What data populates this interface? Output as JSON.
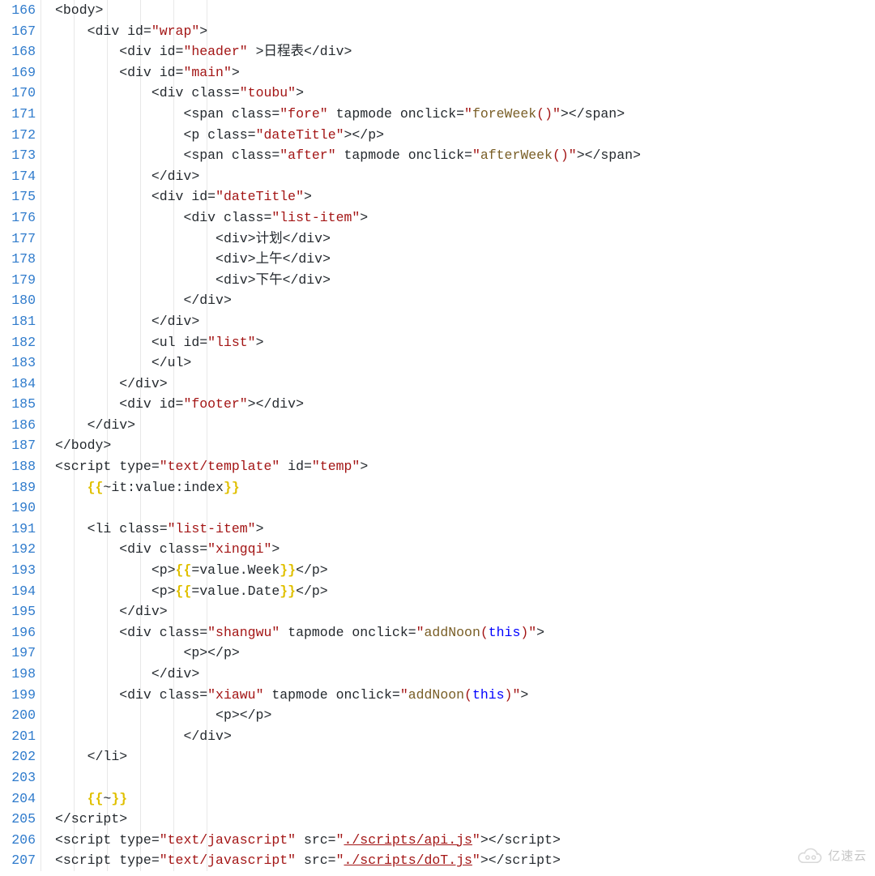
{
  "startLine": 166,
  "lines": [
    {
      "i": 0,
      "html": "<span class='tag'>&lt;body&gt;</span>"
    },
    {
      "i": 1,
      "html": "<span class='tag'>&lt;div</span> <span class='attr'>id=</span><span class='str'>\"wrap\"</span><span class='tag'>&gt;</span>"
    },
    {
      "i": 2,
      "html": "<span class='tag'>&lt;div</span> <span class='attr'>id=</span><span class='str'>\"header\"</span> <span class='tag'>&gt;</span><span class='txt'>日程表</span><span class='tag'>&lt;/div&gt;</span>"
    },
    {
      "i": 2,
      "html": "<span class='tag'>&lt;div</span> <span class='attr'>id=</span><span class='str'>\"main\"</span><span class='tag'>&gt;</span>"
    },
    {
      "i": 3,
      "html": "<span class='tag'>&lt;div</span> <span class='attr'>class=</span><span class='str'>\"toubu\"</span><span class='tag'>&gt;</span>"
    },
    {
      "i": 4,
      "html": "<span class='tag'>&lt;span</span> <span class='attr'>class=</span><span class='str'>\"fore\"</span> <span class='attr'>tapmode</span> <span class='attr'>onclick=</span><span class='str'>\"</span><span class='fn'>foreWeek</span><span class='paren'>()</span><span class='str'>\"</span><span class='tag'>&gt;&lt;/span&gt;</span>"
    },
    {
      "i": 4,
      "html": "<span class='tag'>&lt;p</span> <span class='attr'>class=</span><span class='str'>\"dateTitle\"</span><span class='tag'>&gt;&lt;/p&gt;</span>"
    },
    {
      "i": 4,
      "html": "<span class='tag'>&lt;span</span> <span class='attr'>class=</span><span class='str'>\"after\"</span> <span class='attr'>tapmode</span> <span class='attr'>onclick=</span><span class='str'>\"</span><span class='fn'>afterWeek</span><span class='paren'>()</span><span class='str'>\"</span><span class='tag'>&gt;&lt;/span&gt;</span>"
    },
    {
      "i": 3,
      "html": "<span class='tag'>&lt;/div&gt;</span>"
    },
    {
      "i": 3,
      "html": "<span class='tag'>&lt;div</span> <span class='attr'>id=</span><span class='str'>\"dateTitle\"</span><span class='tag'>&gt;</span>"
    },
    {
      "i": 4,
      "html": "<span class='tag'>&lt;div</span> <span class='attr'>class=</span><span class='str'>\"list-item\"</span><span class='tag'>&gt;</span>"
    },
    {
      "i": 5,
      "html": "<span class='tag'>&lt;div&gt;</span><span class='txt'>计划</span><span class='tag'>&lt;/div&gt;</span>"
    },
    {
      "i": 5,
      "html": "<span class='tag'>&lt;div&gt;</span><span class='txt'>上午</span><span class='tag'>&lt;/div&gt;</span>"
    },
    {
      "i": 5,
      "html": "<span class='tag'>&lt;div&gt;</span><span class='txt'>下午</span><span class='tag'>&lt;/div&gt;</span>"
    },
    {
      "i": 4,
      "html": "<span class='tag'>&lt;/div&gt;</span>"
    },
    {
      "i": 3,
      "html": "<span class='tag'>&lt;/div&gt;</span>"
    },
    {
      "i": 3,
      "html": "<span class='tag'>&lt;ul</span> <span class='attr'>id=</span><span class='str'>\"list\"</span><span class='tag'>&gt;</span>"
    },
    {
      "i": 3,
      "html": "<span class='tag'>&lt;/ul&gt;</span>"
    },
    {
      "i": 2,
      "html": "<span class='tag'>&lt;/div&gt;</span>"
    },
    {
      "i": 2,
      "html": "<span class='tag'>&lt;div</span> <span class='attr'>id=</span><span class='str'>\"footer\"</span><span class='tag'>&gt;&lt;/div&gt;</span>"
    },
    {
      "i": 1,
      "html": "<span class='tag'>&lt;/div&gt;</span>"
    },
    {
      "i": 0,
      "html": "<span class='tag'>&lt;/body&gt;</span>"
    },
    {
      "i": 0,
      "html": "<span class='tag'>&lt;script</span> <span class='attr'>type=</span><span class='str'>\"text/template\"</span> <span class='attr'>id=</span><span class='str'>\"temp\"</span><span class='tag'>&gt;</span>"
    },
    {
      "i": 1,
      "html": "<span class='tmplY'>{{</span><span class='txt'>~it:value:index</span><span class='tmplY'>}}</span>"
    },
    {
      "i": 0,
      "html": ""
    },
    {
      "i": 1,
      "html": "<span class='tag'>&lt;li</span> <span class='attr'>class=</span><span class='str'>\"list-item\"</span><span class='tag'>&gt;</span>"
    },
    {
      "i": 2,
      "html": "<span class='tag'>&lt;div</span> <span class='attr'>class=</span><span class='str'>\"xingqi\"</span><span class='tag'>&gt;</span>"
    },
    {
      "i": 3,
      "html": "<span class='tag'>&lt;p&gt;</span><span class='tmplY'>{{</span><span class='txt'>=value.Week</span><span class='tmplY'>}}</span><span class='tag'>&lt;/p&gt;</span>"
    },
    {
      "i": 3,
      "html": "<span class='tag'>&lt;p&gt;</span><span class='tmplY'>{{</span><span class='txt'>=value.Date</span><span class='tmplY'>}}</span><span class='tag'>&lt;/p&gt;</span>"
    },
    {
      "i": 2,
      "html": "<span class='tag'>&lt;/div&gt;</span>"
    },
    {
      "i": 2,
      "html": "<span class='tag'>&lt;div</span> <span class='attr'>class=</span><span class='str'>\"shangwu\"</span> <span class='attr'>tapmode</span> <span class='attr'>onclick=</span><span class='str'>\"</span><span class='fn'>addNoon</span><span class='paren'>(</span><span class='kw'>this</span><span class='paren'>)</span><span class='str'>\"</span><span class='tag'>&gt;</span>"
    },
    {
      "i": 4,
      "html": "<span class='tag'>&lt;p&gt;&lt;/p&gt;</span>"
    },
    {
      "i": 3,
      "html": "<span class='tag'>&lt;/div&gt;</span>"
    },
    {
      "i": 2,
      "html": "<span class='tag'>&lt;div</span> <span class='attr'>class=</span><span class='str'>\"xiawu\"</span> <span class='attr'>tapmode</span> <span class='attr'>onclick=</span><span class='str'>\"</span><span class='fn'>addNoon</span><span class='paren'>(</span><span class='kw'>this</span><span class='paren'>)</span><span class='str'>\"</span><span class='tag'>&gt;</span>"
    },
    {
      "i": 5,
      "html": "<span class='tag'>&lt;p&gt;&lt;/p&gt;</span>"
    },
    {
      "i": 4,
      "html": "<span class='tag'>&lt;/div&gt;</span>"
    },
    {
      "i": 1,
      "html": "<span class='tag'>&lt;/li&gt;</span>"
    },
    {
      "i": 0,
      "html": ""
    },
    {
      "i": 1,
      "html": "<span class='tmplY'>{{</span><span class='txt'>~</span><span class='tmplY'>}}</span>"
    },
    {
      "i": 0,
      "html": "<span class='tag'>&lt;/script&gt;</span>"
    },
    {
      "i": 0,
      "html": "<span class='tag'>&lt;script</span> <span class='attr'>type=</span><span class='str'>\"text/javascript\"</span> <span class='attr'>src=</span><span class='str'>\"<u>./scripts/api.js</u>\"</span><span class='tag'>&gt;&lt;/script&gt;</span>"
    },
    {
      "i": 0,
      "html": "<span class='tag'>&lt;script</span> <span class='attr'>type=</span><span class='str'>\"text/javascript\"</span> <span class='attr'>src=</span><span class='str'>\"<u>./scripts/doT.js</u>\"</span><span class='tag'>&gt;&lt;/script&gt;</span>"
    }
  ],
  "watermark": "亿速云"
}
